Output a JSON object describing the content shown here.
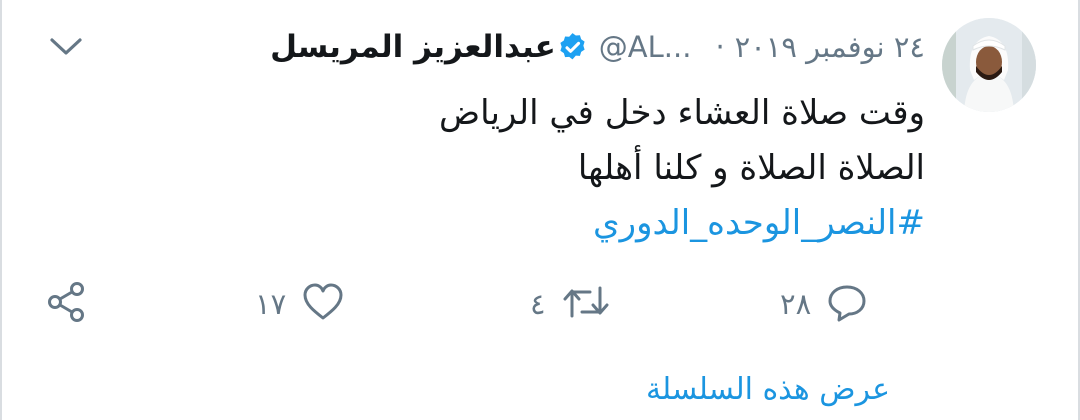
{
  "tweet": {
    "author_name": "عبدالعزيز المريسل",
    "handle": "@AL...",
    "separator": "·",
    "date": "٢٤ نوفمبر ٢٠١٩",
    "lines": [
      "وقت صلاة العشاء دخل في الرياض",
      "الصلاة الصلاة و كلنا أهلها"
    ],
    "hashtag": "#النصر_الوحده_الدوري",
    "actions": {
      "reply_count": "٢٨",
      "retweet_count": "٤",
      "like_count": "١٧"
    },
    "show_thread": "عرض هذه السلسلة"
  },
  "colors": {
    "text": "#14171a",
    "secondary": "#657786",
    "link": "#1b95e0",
    "verified": "#1da1f2"
  },
  "icons": [
    "verified-badge-icon",
    "chevron-down-icon",
    "reply-icon",
    "retweet-icon",
    "like-icon",
    "share-icon"
  ]
}
